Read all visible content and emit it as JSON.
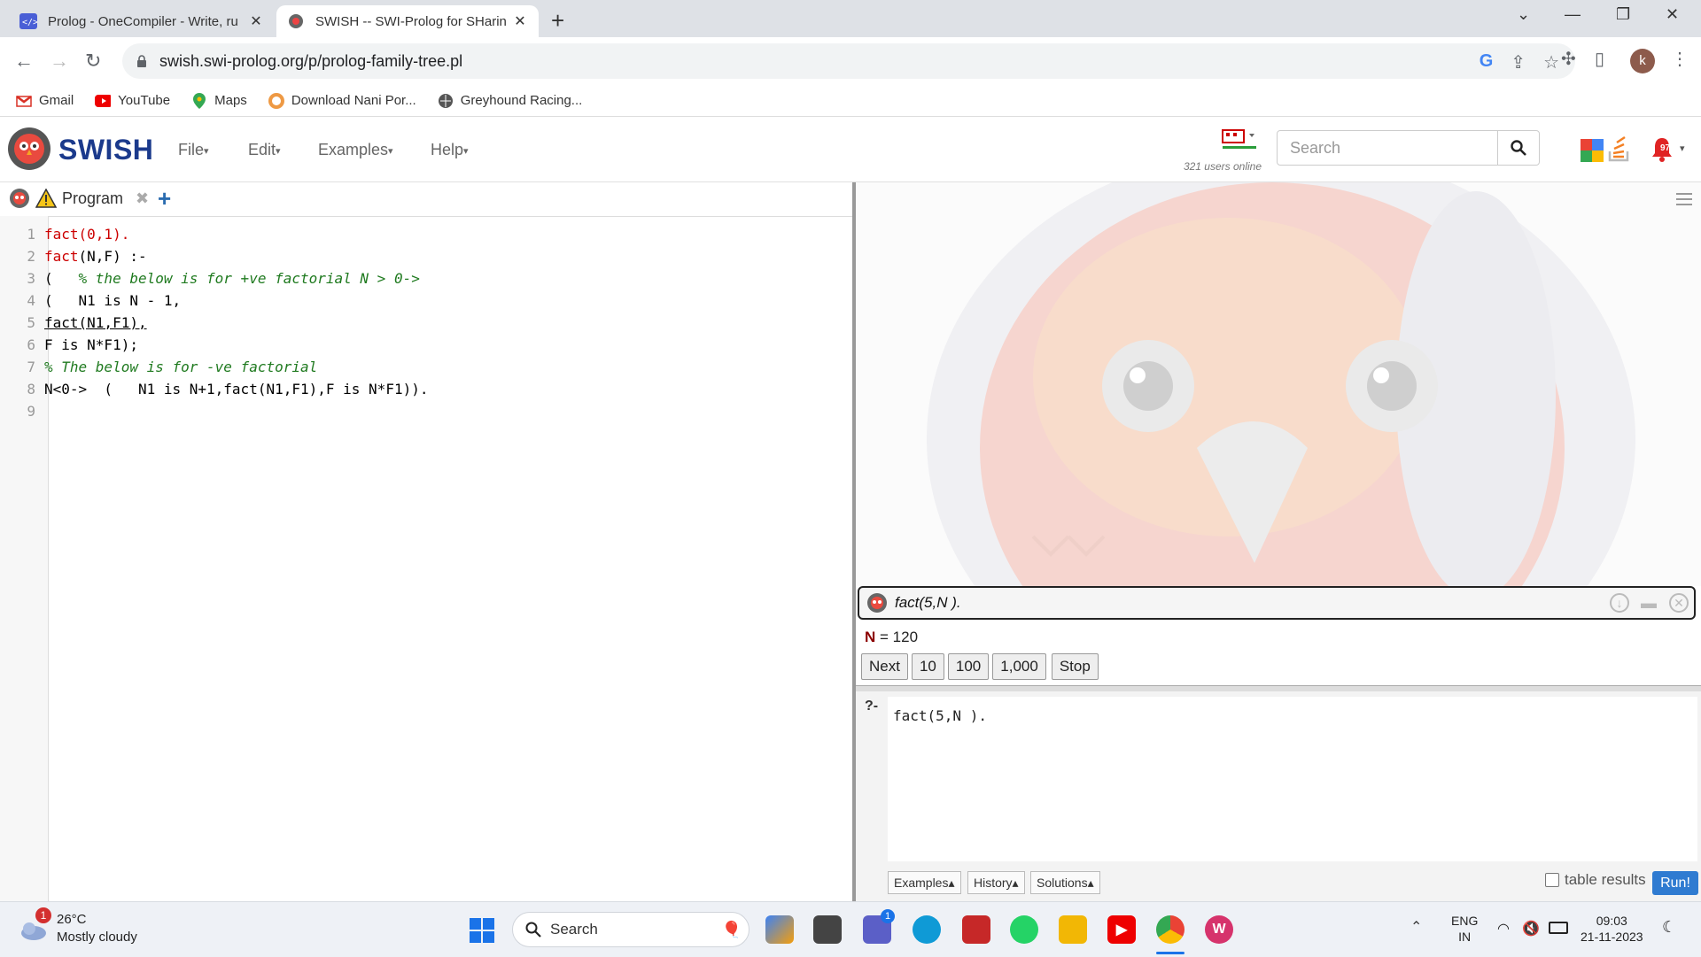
{
  "browser": {
    "tabs": [
      {
        "title": "Prolog - OneCompiler - Write, ru",
        "active": false
      },
      {
        "title": "SWISH -- SWI-Prolog for SHarin",
        "active": true
      }
    ],
    "url": "swish.swi-prolog.org/p/prolog-family-tree.pl",
    "profile_initial": "k",
    "bookmarks": [
      {
        "label": "Gmail",
        "icon": "gmail-icon"
      },
      {
        "label": "YouTube",
        "icon": "youtube-icon"
      },
      {
        "label": "Maps",
        "icon": "maps-icon"
      },
      {
        "label": "Download Nani Por...",
        "icon": "download-icon"
      },
      {
        "label": "Greyhound Racing...",
        "icon": "globe-icon"
      }
    ]
  },
  "swish": {
    "brand": "SWISH",
    "menus": [
      "File",
      "Edit",
      "Examples",
      "Help"
    ],
    "users_online": "321 users online",
    "search_placeholder": "Search",
    "notification_count": "975",
    "editor_tab": "Program"
  },
  "code_lines": [
    {
      "n": "1"
    },
    {
      "n": "2"
    },
    {
      "n": "3"
    },
    {
      "n": "4"
    },
    {
      "n": "5"
    },
    {
      "n": "6"
    },
    {
      "n": "7"
    },
    {
      "n": "8"
    },
    {
      "n": "9"
    }
  ],
  "code": {
    "l1": "fact(0,1).",
    "l2_head": "fact",
    "l2_rest": "(N,F) :-",
    "l3_open": "(   ",
    "l3_comment": "% the below is for +ve factorial N > 0->",
    "l4": "(   N1 is N - 1,",
    "l5": "fact(N1,F1),",
    "l6": "F is N*F1);",
    "l7_comment": "% The below is for -ve factorial",
    "l8": "N<0->  (   N1 is N+1,fact(N1,F1),F is N*F1))."
  },
  "answer": {
    "query": "fact(5,N ).",
    "result_var": "N",
    "result_value": " = 120",
    "buttons": [
      "Next",
      "10",
      "100",
      "1,000",
      "Stop"
    ]
  },
  "query_editor": {
    "prompt": "?-",
    "text": "fact(5,N ).",
    "examples_btn": "Examples▴",
    "history_btn": "History▴",
    "solutions_btn": "Solutions▴",
    "table_results_label": "table results",
    "run_label": "Run!"
  },
  "taskbar": {
    "weather_temp": "26°C",
    "weather_desc": "Mostly cloudy",
    "weather_badge": "1",
    "search_label": "Search",
    "lang_top": "ENG",
    "lang_bottom": "IN",
    "time": "09:03",
    "date": "21-11-2023",
    "teams_badge": "1"
  }
}
